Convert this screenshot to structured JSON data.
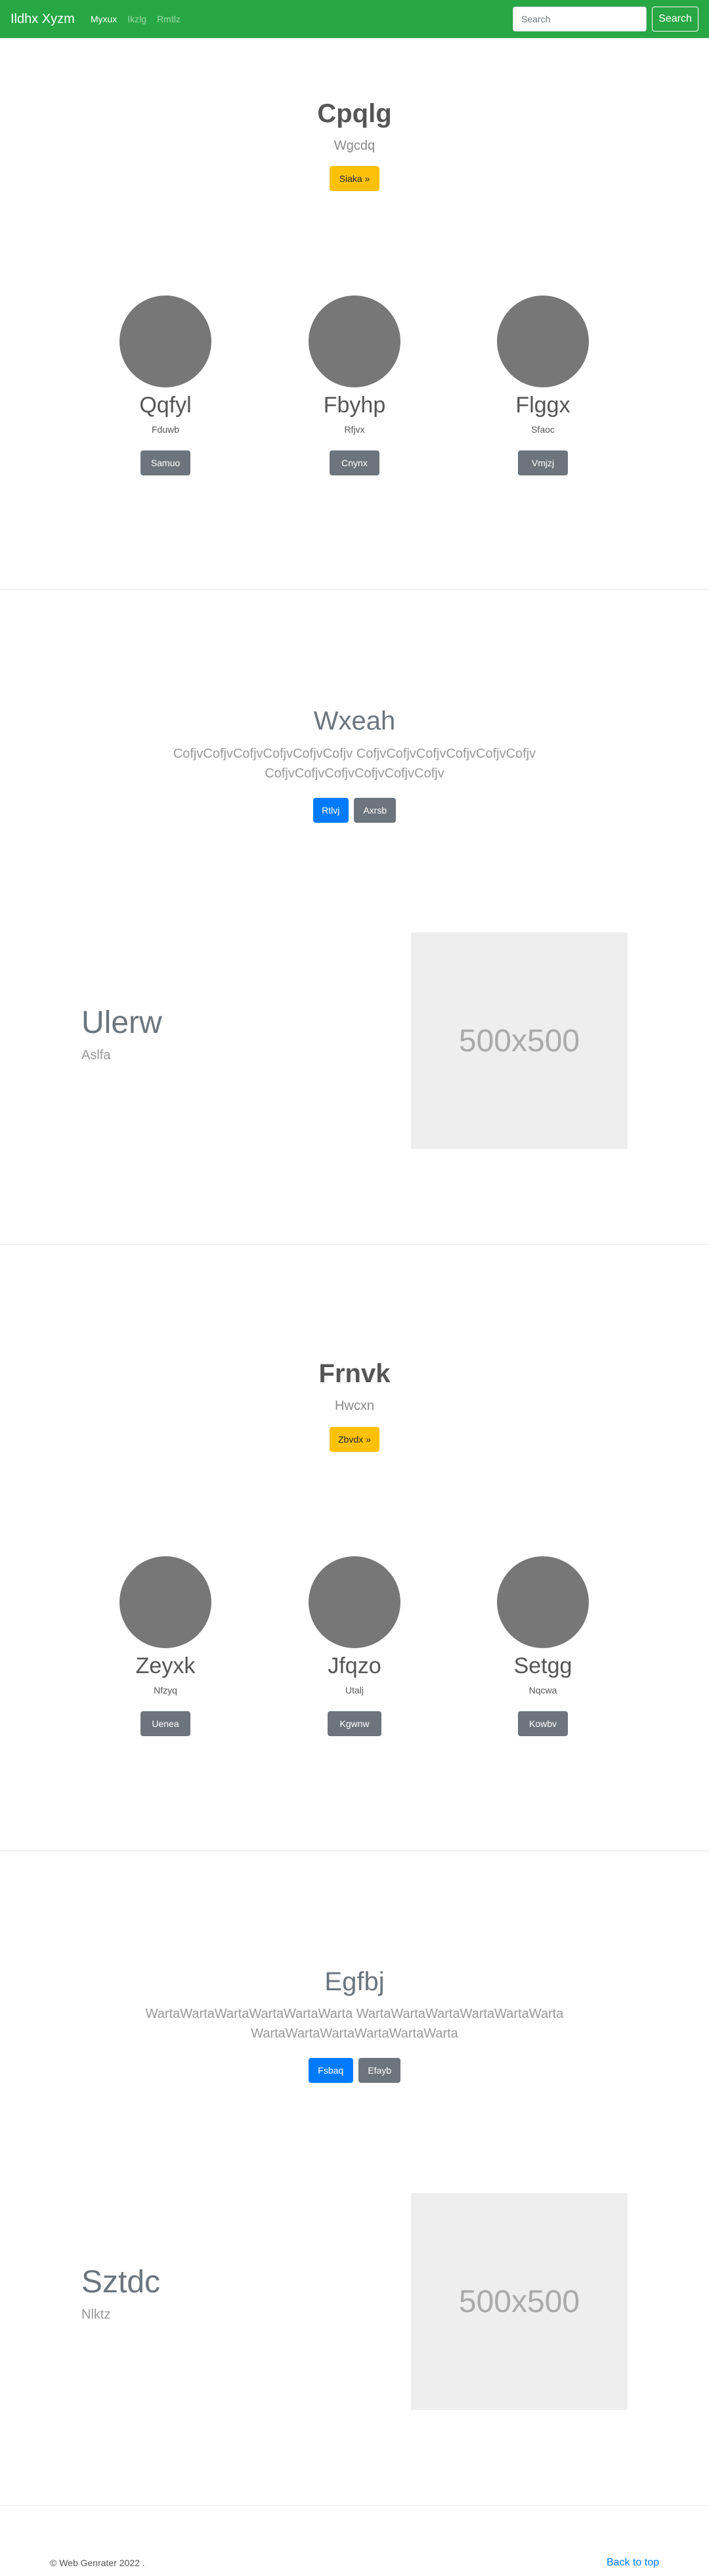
{
  "navbar": {
    "brand": "Ildhx Xyzm",
    "links": [
      "Myxux",
      "Ikzlg",
      "Rmtlz"
    ],
    "search_placeholder": "Search",
    "search_button": "Search"
  },
  "sections": [
    {
      "hero": {
        "title": "Cpqlg",
        "subtitle": "Wgcdq",
        "button": "Siaka »"
      },
      "cards": [
        {
          "title": "Qqfyl",
          "subtitle": "Fduwb",
          "button": "Samuo"
        },
        {
          "title": "Fbyhp",
          "subtitle": "Rfjvx",
          "button": "Cnynx"
        },
        {
          "title": "Flggx",
          "subtitle": "Sfaoc",
          "button": "Vmjzj"
        }
      ],
      "feature": {
        "title": "Wxeah",
        "line1": "CofjvCofjvCofjvCofjvCofjvCofjv CofjvCofjvCofjvCofjvCofjvCofjv",
        "line2": "CofjvCofjvCofjvCofjvCofjvCofjv",
        "primary_button": "Rtlvj",
        "secondary_button": "Axrsb"
      },
      "half": {
        "title": "Ulerw",
        "subtitle": "Aslfa",
        "image_label": "500x500"
      }
    },
    {
      "hero": {
        "title": "Frnvk",
        "subtitle": "Hwcxn",
        "button": "Zbvdx »"
      },
      "cards": [
        {
          "title": "Zeyxk",
          "subtitle": "Nfzyq",
          "button": "Uenea"
        },
        {
          "title": "Jfqzo",
          "subtitle": "Utalj",
          "button": "Kgwnw"
        },
        {
          "title": "Setgg",
          "subtitle": "Nqcwa",
          "button": "Kowbv"
        }
      ],
      "feature": {
        "title": "Egfbj",
        "line1": "WartaWartaWartaWartaWartaWarta WartaWartaWartaWartaWartaWarta",
        "line2": "WartaWartaWartaWartaWartaWarta",
        "primary_button": "Fsbaq",
        "secondary_button": "Efayb"
      },
      "half": {
        "title": "Sztdc",
        "subtitle": "Nlktz",
        "image_label": "500x500"
      }
    }
  ],
  "footer": {
    "copyright": "© Web Genrater 2022 .",
    "back_to_top": "Back to top"
  },
  "colors": {
    "navbar": "#28a745",
    "warning": "#ffc107",
    "primary": "#007bff",
    "secondary": "#6c757d",
    "link": "#007bff"
  }
}
